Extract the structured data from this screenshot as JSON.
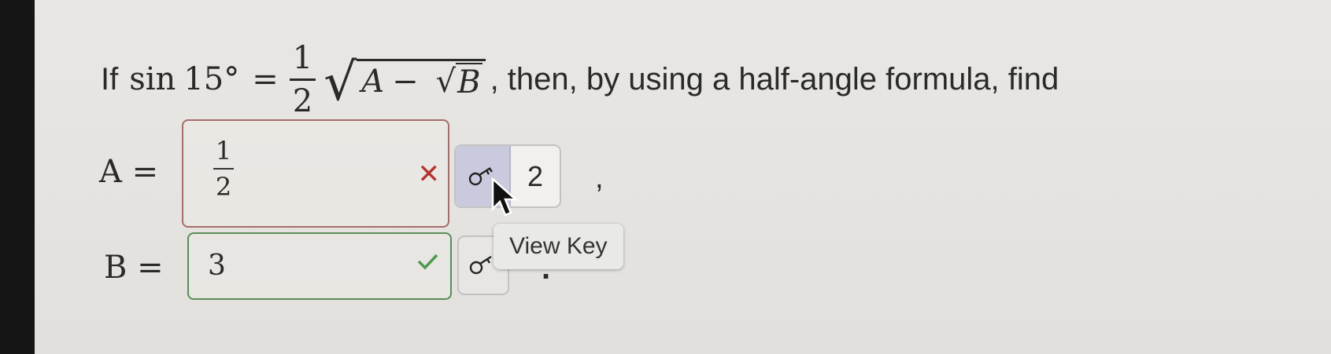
{
  "question": {
    "prefix": "If",
    "func": "sin",
    "angle": "15°",
    "equals": "=",
    "frac_num": "1",
    "frac_den": "2",
    "var_a": "A",
    "minus": "−",
    "var_b": "B",
    "suffix": ", then, by using a half-angle formula, find"
  },
  "answers": {
    "a": {
      "label": "A =",
      "value_num": "1",
      "value_den": "2",
      "status": "incorrect",
      "status_mark": "✕",
      "key_count": "2",
      "trailing": ","
    },
    "b": {
      "label": "B =",
      "value": "3",
      "status": "correct",
      "trailing": "."
    }
  },
  "tooltip": {
    "text": "View Key"
  },
  "colors": {
    "incorrect": "#b3312d",
    "correct": "#4f9a4f",
    "key_button_active": "#c9cadd"
  },
  "icons": {
    "key": "key-icon",
    "incorrect": "x-icon",
    "correct": "checkmark-icon",
    "cursor": "mouse-pointer-icon"
  }
}
